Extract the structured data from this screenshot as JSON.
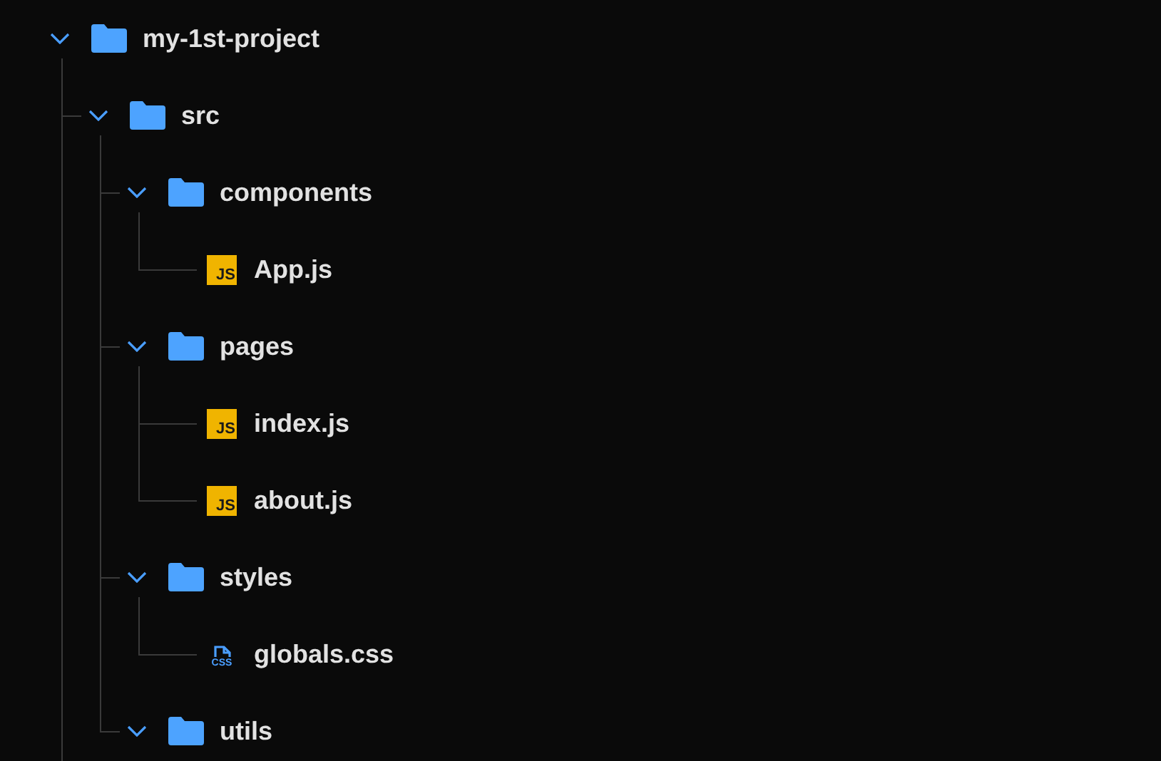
{
  "tree": {
    "name": "my-1st-project",
    "kind": "folder",
    "expanded": true,
    "children": [
      {
        "name": "src",
        "kind": "folder",
        "expanded": true,
        "children": [
          {
            "name": "components",
            "kind": "folder",
            "expanded": true,
            "children": [
              {
                "name": "App.js",
                "kind": "js-file",
                "badge": "JS"
              }
            ]
          },
          {
            "name": "pages",
            "kind": "folder",
            "expanded": true,
            "children": [
              {
                "name": "index.js",
                "kind": "js-file",
                "badge": "JS"
              },
              {
                "name": "about.js",
                "kind": "js-file",
                "badge": "JS"
              }
            ]
          },
          {
            "name": "styles",
            "kind": "folder",
            "expanded": true,
            "children": [
              {
                "name": "globals.css",
                "kind": "css-file",
                "badge": "CSS"
              }
            ]
          },
          {
            "name": "utils",
            "kind": "folder",
            "expanded": true
          }
        ]
      }
    ]
  }
}
